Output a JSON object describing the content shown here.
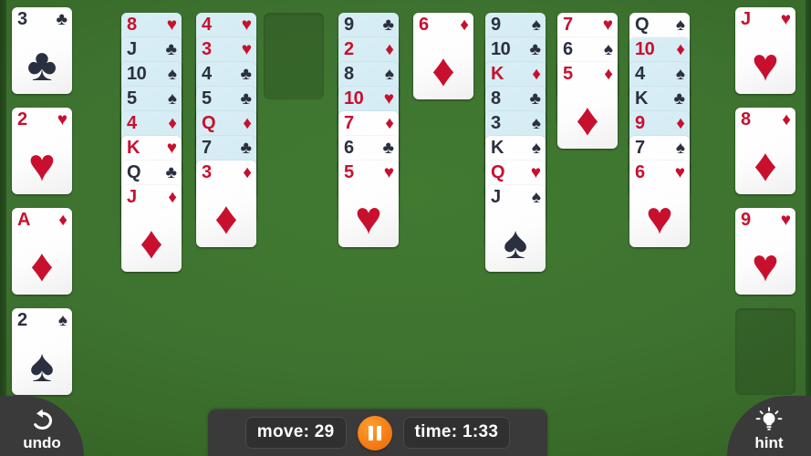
{
  "theme": {
    "felt_green": "#3a6b2e",
    "card_white": "#ffffff",
    "card_highlight": "#d3ebf4",
    "red_suit": "#c8102e",
    "black_suit": "#2b3040",
    "bar_dark": "#3a3a3a",
    "pause_orange": "#f47b14"
  },
  "suits": {
    "hearts": "♥",
    "diamonds": "♦",
    "clubs": "♣",
    "spades": "♠"
  },
  "free_cells": {
    "name": "left-free-cell-column",
    "cards": [
      {
        "rank": "3",
        "suit": "clubs",
        "glyph": "♣",
        "color": "black",
        "highlighted": false
      },
      {
        "rank": "2",
        "suit": "hearts",
        "glyph": "♥",
        "color": "red",
        "highlighted": false
      },
      {
        "rank": "A",
        "suit": "diamonds",
        "glyph": "♦",
        "color": "red",
        "highlighted": false
      },
      {
        "rank": "2",
        "suit": "spades",
        "glyph": "♠",
        "color": "black",
        "highlighted": false
      }
    ]
  },
  "foundations": {
    "name": "right-foundation-column",
    "cards": [
      {
        "rank": "J",
        "suit": "hearts",
        "glyph": "♥",
        "color": "red",
        "highlighted": false
      },
      {
        "rank": "8",
        "suit": "diamonds",
        "glyph": "♦",
        "color": "red",
        "highlighted": false
      },
      {
        "rank": "9",
        "suit": "hearts",
        "glyph": "♥",
        "color": "red",
        "highlighted": false
      }
    ],
    "empty_slots": 1
  },
  "tableau": {
    "columns": [
      {
        "index": 1,
        "empty": false,
        "cards": [
          {
            "rank": "8",
            "suit": "hearts",
            "glyph": "♥",
            "color": "red",
            "highlighted": true
          },
          {
            "rank": "J",
            "suit": "clubs",
            "glyph": "♣",
            "color": "black",
            "highlighted": true
          },
          {
            "rank": "10",
            "suit": "spades",
            "glyph": "♠",
            "color": "black",
            "highlighted": true
          },
          {
            "rank": "5",
            "suit": "spades",
            "glyph": "♠",
            "color": "black",
            "highlighted": true
          },
          {
            "rank": "4",
            "suit": "diamonds",
            "glyph": "♦",
            "color": "red",
            "highlighted": true
          },
          {
            "rank": "K",
            "suit": "hearts",
            "glyph": "♥",
            "color": "red",
            "highlighted": false
          },
          {
            "rank": "Q",
            "suit": "clubs",
            "glyph": "♣",
            "color": "black",
            "highlighted": false
          },
          {
            "rank": "J",
            "suit": "diamonds",
            "glyph": "♦",
            "color": "red",
            "highlighted": false
          }
        ]
      },
      {
        "index": 2,
        "empty": false,
        "cards": [
          {
            "rank": "4",
            "suit": "hearts",
            "glyph": "♥",
            "color": "red",
            "highlighted": true
          },
          {
            "rank": "3",
            "suit": "hearts",
            "glyph": "♥",
            "color": "red",
            "highlighted": true
          },
          {
            "rank": "4",
            "suit": "clubs",
            "glyph": "♣",
            "color": "black",
            "highlighted": true
          },
          {
            "rank": "5",
            "suit": "clubs",
            "glyph": "♣",
            "color": "black",
            "highlighted": true
          },
          {
            "rank": "Q",
            "suit": "diamonds",
            "glyph": "♦",
            "color": "red",
            "highlighted": true
          },
          {
            "rank": "7",
            "suit": "clubs",
            "glyph": "♣",
            "color": "black",
            "highlighted": true
          },
          {
            "rank": "3",
            "suit": "diamonds",
            "glyph": "♦",
            "color": "red",
            "highlighted": false
          }
        ]
      },
      {
        "index": 3,
        "empty": true,
        "cards": []
      },
      {
        "index": 4,
        "empty": false,
        "cards": [
          {
            "rank": "9",
            "suit": "clubs",
            "glyph": "♣",
            "color": "black",
            "highlighted": true
          },
          {
            "rank": "2",
            "suit": "diamonds",
            "glyph": "♦",
            "color": "red",
            "highlighted": true
          },
          {
            "rank": "8",
            "suit": "spades",
            "glyph": "♠",
            "color": "black",
            "highlighted": true
          },
          {
            "rank": "10",
            "suit": "hearts",
            "glyph": "♥",
            "color": "red",
            "highlighted": true
          },
          {
            "rank": "7",
            "suit": "diamonds",
            "glyph": "♦",
            "color": "red",
            "highlighted": false
          },
          {
            "rank": "6",
            "suit": "clubs",
            "glyph": "♣",
            "color": "black",
            "highlighted": false
          },
          {
            "rank": "5",
            "suit": "hearts",
            "glyph": "♥",
            "color": "red",
            "highlighted": false
          }
        ]
      },
      {
        "index": 5,
        "empty": false,
        "cards": [
          {
            "rank": "6",
            "suit": "diamonds",
            "glyph": "♦",
            "color": "red",
            "highlighted": false
          }
        ]
      },
      {
        "index": 6,
        "empty": false,
        "cards": [
          {
            "rank": "9",
            "suit": "spades",
            "glyph": "♠",
            "color": "black",
            "highlighted": true
          },
          {
            "rank": "10",
            "suit": "clubs",
            "glyph": "♣",
            "color": "black",
            "highlighted": true
          },
          {
            "rank": "K",
            "suit": "diamonds",
            "glyph": "♦",
            "color": "red",
            "highlighted": true
          },
          {
            "rank": "8",
            "suit": "clubs",
            "glyph": "♣",
            "color": "black",
            "highlighted": true
          },
          {
            "rank": "3",
            "suit": "spades",
            "glyph": "♠",
            "color": "black",
            "highlighted": true
          },
          {
            "rank": "K",
            "suit": "spades",
            "glyph": "♠",
            "color": "black",
            "highlighted": false
          },
          {
            "rank": "Q",
            "suit": "hearts",
            "glyph": "♥",
            "color": "red",
            "highlighted": false
          },
          {
            "rank": "J",
            "suit": "spades",
            "glyph": "♠",
            "color": "black",
            "highlighted": false
          }
        ]
      },
      {
        "index": 7,
        "empty": false,
        "cards": [
          {
            "rank": "7",
            "suit": "hearts",
            "glyph": "♥",
            "color": "red",
            "highlighted": false
          },
          {
            "rank": "6",
            "suit": "spades",
            "glyph": "♠",
            "color": "black",
            "highlighted": false
          },
          {
            "rank": "5",
            "suit": "diamonds",
            "glyph": "♦",
            "color": "red",
            "highlighted": false
          }
        ]
      },
      {
        "index": 8,
        "empty": false,
        "cards": [
          {
            "rank": "Q",
            "suit": "spades",
            "glyph": "♠",
            "color": "black",
            "highlighted": false
          },
          {
            "rank": "10",
            "suit": "diamonds",
            "glyph": "♦",
            "color": "red",
            "highlighted": true
          },
          {
            "rank": "4",
            "suit": "spades",
            "glyph": "♠",
            "color": "black",
            "highlighted": true
          },
          {
            "rank": "K",
            "suit": "clubs",
            "glyph": "♣",
            "color": "black",
            "highlighted": true
          },
          {
            "rank": "9",
            "suit": "diamonds",
            "glyph": "♦",
            "color": "red",
            "highlighted": true
          },
          {
            "rank": "7",
            "suit": "spades",
            "glyph": "♠",
            "color": "black",
            "highlighted": false
          },
          {
            "rank": "6",
            "suit": "hearts",
            "glyph": "♥",
            "color": "red",
            "highlighted": false
          }
        ]
      }
    ]
  },
  "toolbar": {
    "move_label": "move: 29",
    "time_label": "time: 1:33",
    "pause_icon": "pause-icon",
    "undo_label": "undo",
    "undo_icon": "undo-arrow-icon",
    "hint_label": "hint",
    "hint_icon": "lightbulb-icon"
  }
}
